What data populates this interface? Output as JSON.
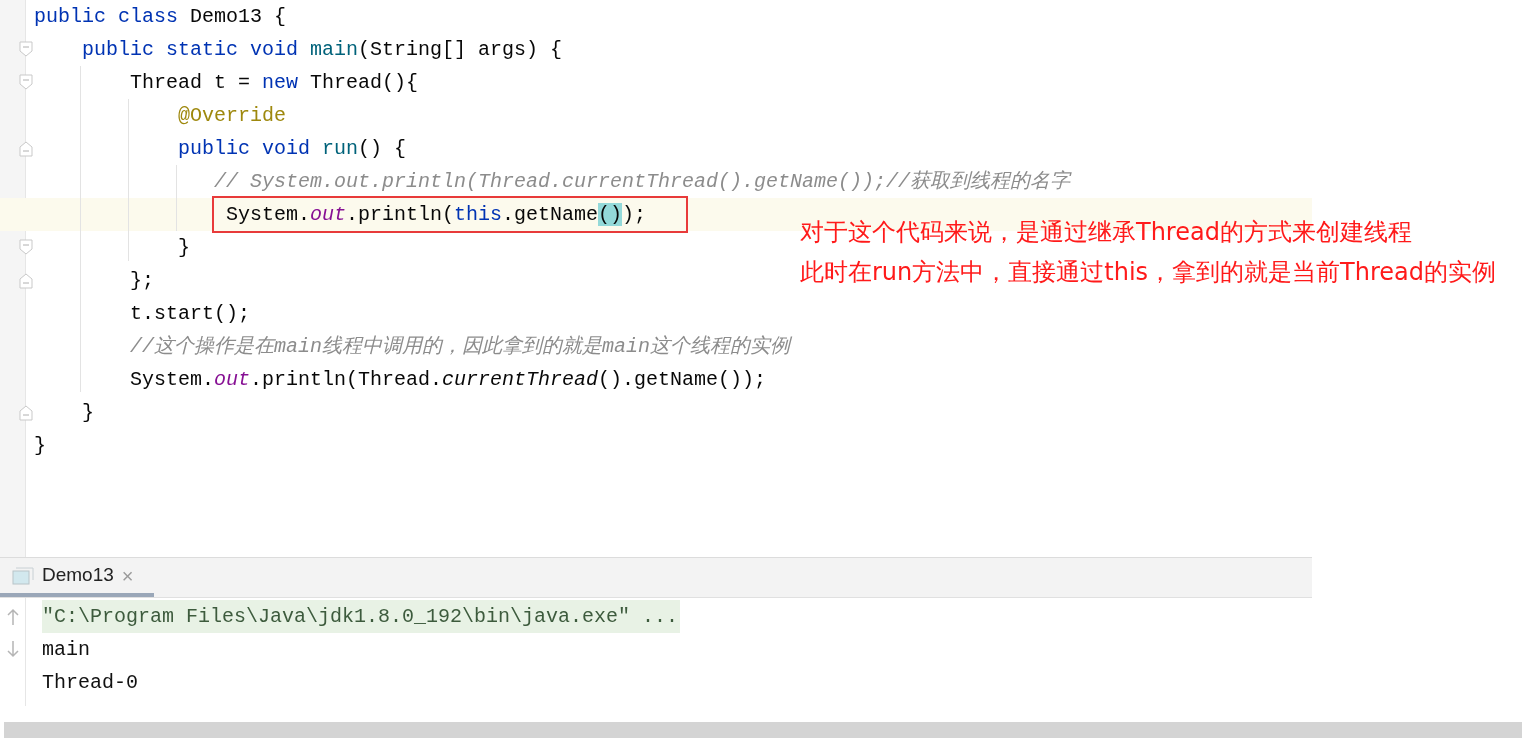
{
  "editor": {
    "lines": [
      {
        "fold_start": false,
        "fold_end": false,
        "current": false,
        "boxed": false,
        "tokens": [
          {
            "kind": "keyword",
            "text": "public class "
          },
          {
            "kind": "plain",
            "text": "Demo13 {"
          }
        ]
      },
      {
        "fold_start": true,
        "fold_end": false,
        "current": false,
        "boxed": false,
        "tokens": [
          {
            "kind": "keyword",
            "text": "    public static void "
          },
          {
            "kind": "declaration",
            "text": "main"
          },
          {
            "kind": "plain",
            "text": "(String[] args) {"
          }
        ]
      },
      {
        "fold_start": true,
        "fold_end": false,
        "current": false,
        "boxed": false,
        "tokens": [
          {
            "kind": "plain",
            "text": "        Thread t = "
          },
          {
            "kind": "keyword",
            "text": "new "
          },
          {
            "kind": "plain",
            "text": "Thread(){"
          }
        ]
      },
      {
        "fold_start": false,
        "fold_end": false,
        "current": false,
        "boxed": false,
        "tokens": [
          {
            "kind": "annotation",
            "text": "            @Override"
          }
        ]
      },
      {
        "fold_start": false,
        "fold_end": true,
        "current": false,
        "boxed": false,
        "tokens": [
          {
            "kind": "keyword",
            "text": "            public void "
          },
          {
            "kind": "declaration",
            "text": "run"
          },
          {
            "kind": "plain",
            "text": "() {"
          }
        ]
      },
      {
        "fold_start": false,
        "fold_end": false,
        "current": false,
        "boxed": false,
        "tokens": [
          {
            "kind": "comment",
            "text": "               // System.out.println(Thread.currentThread().getName());//获取到线程的名字"
          }
        ]
      },
      {
        "fold_start": false,
        "fold_end": false,
        "current": true,
        "boxed": true,
        "tokens": [
          {
            "kind": "plain",
            "text": "                System."
          },
          {
            "kind": "field",
            "text": "out"
          },
          {
            "kind": "plain",
            "text": ".println("
          },
          {
            "kind": "keyword",
            "text": "this"
          },
          {
            "kind": "plain",
            "text": ".getName"
          },
          {
            "kind": "match",
            "text": "()"
          },
          {
            "kind": "plain",
            "text": ");"
          }
        ]
      },
      {
        "fold_start": true,
        "fold_end": false,
        "current": false,
        "boxed": false,
        "tokens": [
          {
            "kind": "plain",
            "text": "            }"
          }
        ]
      },
      {
        "fold_start": false,
        "fold_end": true,
        "current": false,
        "boxed": false,
        "tokens": [
          {
            "kind": "plain",
            "text": "        };"
          }
        ]
      },
      {
        "fold_start": false,
        "fold_end": false,
        "current": false,
        "boxed": false,
        "tokens": [
          {
            "kind": "plain",
            "text": "        t.start();"
          }
        ]
      },
      {
        "fold_start": false,
        "fold_end": false,
        "current": false,
        "boxed": false,
        "tokens": [
          {
            "kind": "comment",
            "text": "        //这个操作是在main线程中调用的，因此拿到的就是main这个线程的实例"
          }
        ]
      },
      {
        "fold_start": false,
        "fold_end": false,
        "current": false,
        "boxed": false,
        "tokens": [
          {
            "kind": "plain",
            "text": "        System."
          },
          {
            "kind": "field",
            "text": "out"
          },
          {
            "kind": "plain",
            "text": ".println(Thread."
          },
          {
            "kind": "static",
            "text": "currentThread"
          },
          {
            "kind": "plain",
            "text": "().getName());"
          }
        ]
      },
      {
        "fold_start": false,
        "fold_end": true,
        "current": false,
        "boxed": false,
        "tokens": [
          {
            "kind": "plain",
            "text": "    }"
          }
        ]
      },
      {
        "fold_start": false,
        "fold_end": false,
        "current": false,
        "boxed": false,
        "tokens": [
          {
            "kind": "plain",
            "text": "}"
          }
        ]
      }
    ]
  },
  "annotation": [
    "对于这个代码来说，是通过继承Thread的方式来创建线程",
    "此时在run方法中，直接通过this，拿到的就是当前Thread的实例"
  ],
  "run_panel": {
    "tab": {
      "label": "Demo13",
      "close": "×",
      "selected": true
    },
    "output": [
      {
        "kind": "command",
        "text": "\"C:\\Program Files\\Java\\jdk1.8.0_192\\bin\\java.exe\" ..."
      },
      {
        "kind": "stdout",
        "text": "main"
      },
      {
        "kind": "stdout",
        "text": "Thread-0"
      }
    ]
  }
}
